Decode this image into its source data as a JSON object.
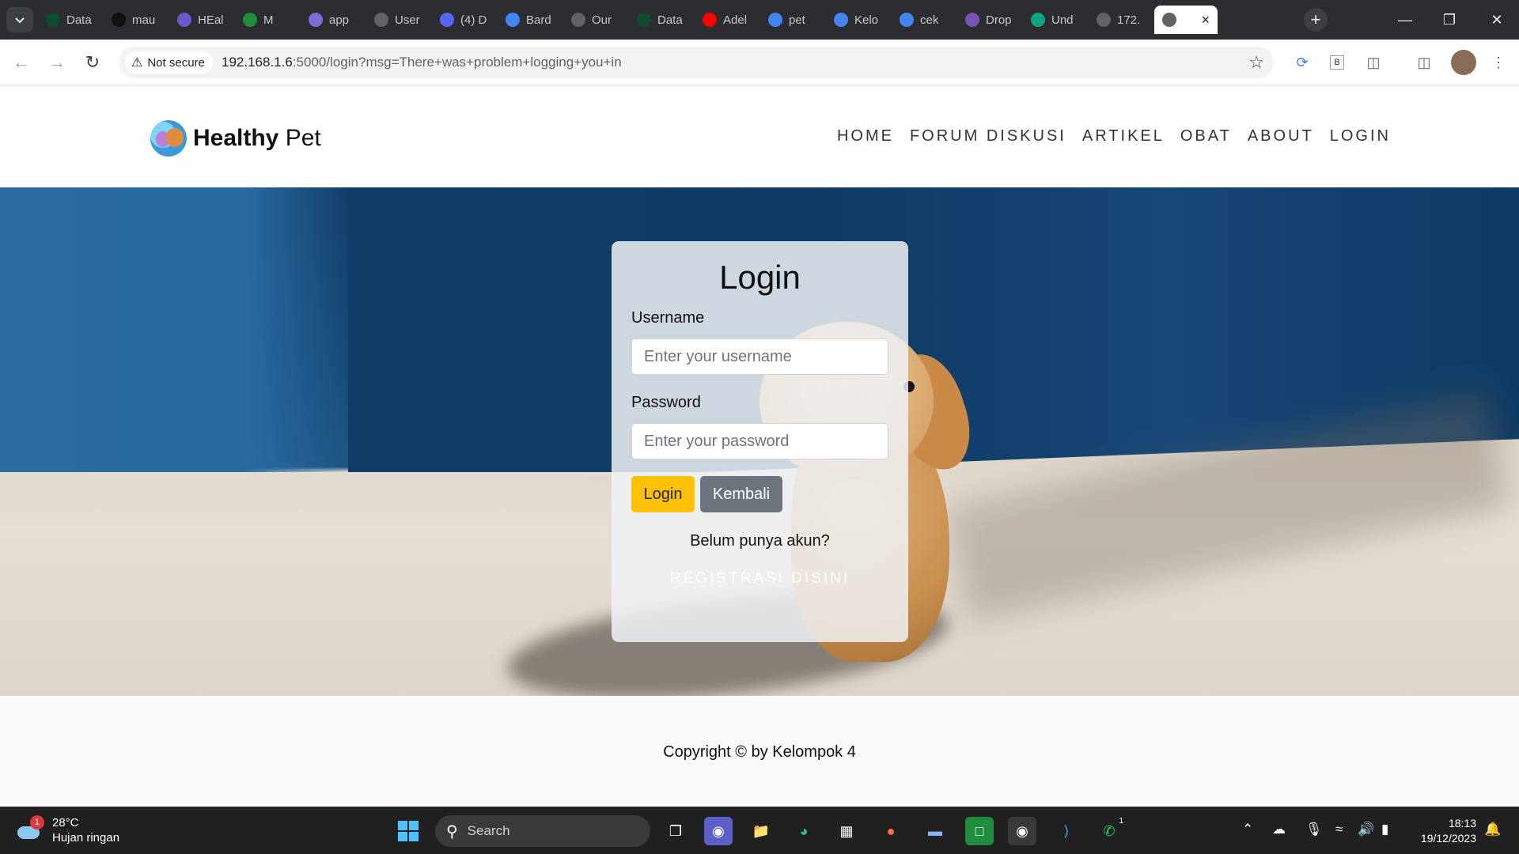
{
  "browser": {
    "tabs": [
      {
        "label": "Data",
        "icon": "mongodb-leaf-icon",
        "color": "#0d4d2b"
      },
      {
        "label": "mau",
        "icon": "github-icon",
        "color": "#111111"
      },
      {
        "label": "HEal",
        "icon": "app-icon",
        "color": "#6a5acd"
      },
      {
        "label": "M",
        "icon": "meet-icon",
        "color": "#1e8e3e"
      },
      {
        "label": "app",
        "icon": "app-icon",
        "color": "#7b6cd9"
      },
      {
        "label": "User",
        "icon": "globe-icon",
        "color": "#5f6368"
      },
      {
        "label": "(4) D",
        "icon": "discord-icon",
        "color": "#5865f2"
      },
      {
        "label": "Bard",
        "icon": "bard-sparkle-icon",
        "color": "#4285f4"
      },
      {
        "label": "Our",
        "icon": "globe-icon",
        "color": "#5f6368"
      },
      {
        "label": "Data",
        "icon": "mongodb-leaf-icon",
        "color": "#0d4d2b"
      },
      {
        "label": "Adel",
        "icon": "youtube-icon",
        "color": "#ff0000"
      },
      {
        "label": "pet",
        "icon": "google-icon",
        "color": "#4285f4"
      },
      {
        "label": "Kelo",
        "icon": "docs-icon",
        "color": "#4285f4"
      },
      {
        "label": "cek",
        "icon": "google-icon",
        "color": "#4285f4"
      },
      {
        "label": "Drop",
        "icon": "bootstrap-icon",
        "color": "#7952b3"
      },
      {
        "label": "Und",
        "icon": "chatgpt-icon",
        "color": "#10a37f"
      },
      {
        "label": "172.",
        "icon": "globe-icon",
        "color": "#5f6368"
      }
    ],
    "active_tab_icon": "globe-icon",
    "security_label": "Not secure",
    "url_host": "192.168.1.6",
    "url_rest": ":5000/login?msg=There+was+problem+logging+you+in"
  },
  "site": {
    "brand_bold": "Healthy",
    "brand_light": " Pet",
    "nav": [
      "HOME",
      "FORUM DISKUSI",
      "ARTIKEL",
      "OBAT",
      "ABOUT",
      "LOGIN"
    ]
  },
  "login": {
    "title": "Login",
    "username_label": "Username",
    "username_placeholder": "Enter your username",
    "password_label": "Password",
    "password_placeholder": "Enter your password",
    "login_button": "Login",
    "back_button": "Kembali",
    "signup_question": "Belum punya akun?",
    "signup_link": "REGISTRASI DISINI"
  },
  "footer": {
    "copyright": "Copyright © by Kelompok 4"
  },
  "taskbar": {
    "weather_temp": "28°C",
    "weather_desc": "Hujan ringan",
    "weather_badge": "1",
    "search_label": "Search",
    "time": "18:13",
    "date": "19/12/2023",
    "whatsapp_badge": "1"
  },
  "colors": {
    "login_button": "#ffc107",
    "back_button": "#6c757d"
  }
}
